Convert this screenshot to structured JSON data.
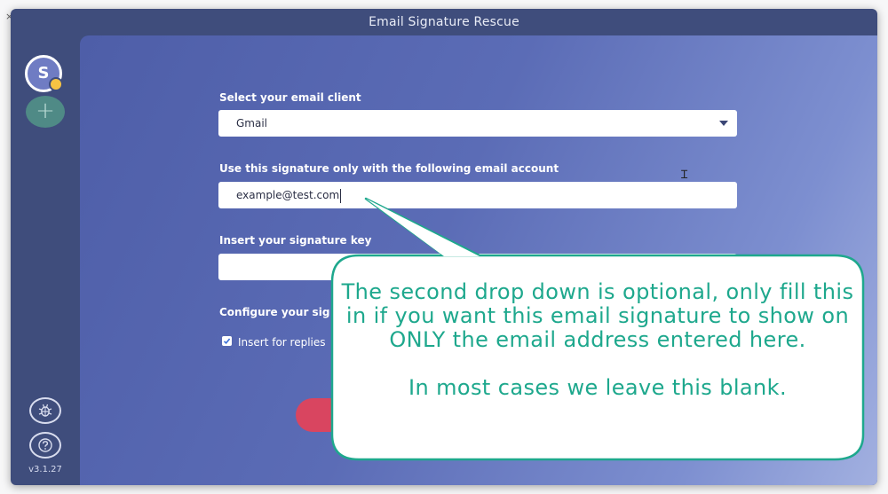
{
  "window": {
    "title": "Email Signature Rescue"
  },
  "sidebar": {
    "avatar_initial": "S",
    "add_account_symbol": "+",
    "version": "v3.1.27",
    "icons": {
      "bug": "bug-icon",
      "help": "help-icon"
    }
  },
  "form": {
    "client_label": "Select your email client",
    "client_value": "Gmail",
    "account_label": "Use this signature only with the following email account",
    "account_value": "example@test.com",
    "key_label": "Insert your signature key",
    "key_value": "",
    "configure_label": "Configure your sig",
    "insert_replies_label": "Insert for replies",
    "insert_replies_checked": true
  },
  "callout": {
    "line1": "The second drop down is optional, only fill this in if you want this email signature to show on ONLY the email address entered here.",
    "line2": "In most cases we leave this blank."
  },
  "colors": {
    "window_bg": "#3f4d7c",
    "accent_red": "#d94560",
    "callout_border": "#1ea88d",
    "callout_text": "#1ea88d"
  }
}
